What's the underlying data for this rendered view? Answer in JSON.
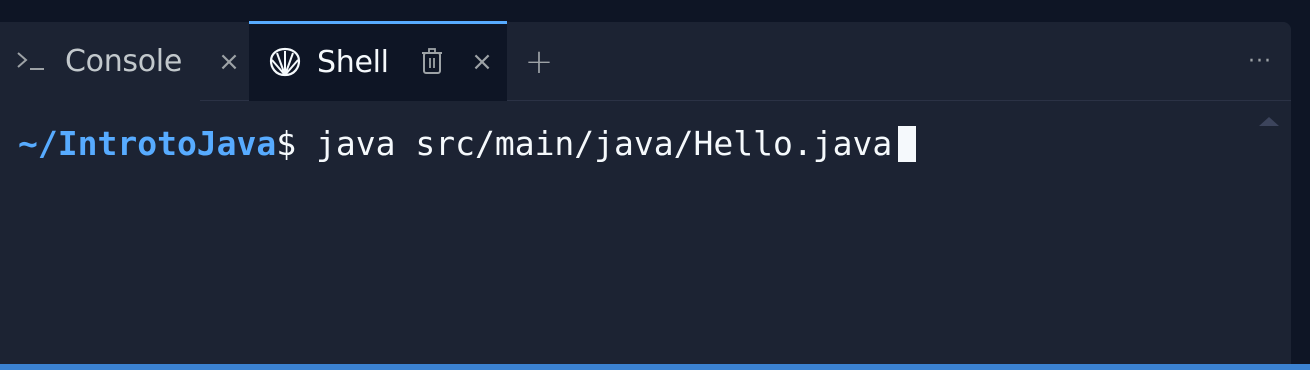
{
  "tabs": {
    "console": {
      "label": "Console",
      "icon": "terminal-prompt-icon",
      "close": "×"
    },
    "shell": {
      "label": "Shell",
      "icon": "shell-icon",
      "close": "×",
      "active": true
    },
    "add_label": "+",
    "more_label": "···"
  },
  "terminal": {
    "prompt_path": "~/IntrotoJava",
    "prompt_symbol": "$",
    "command": " java src/main/java/Hello.java"
  },
  "colors": {
    "accent": "#57abff",
    "background": "#1c2333",
    "active_tab": "#0e1525"
  }
}
